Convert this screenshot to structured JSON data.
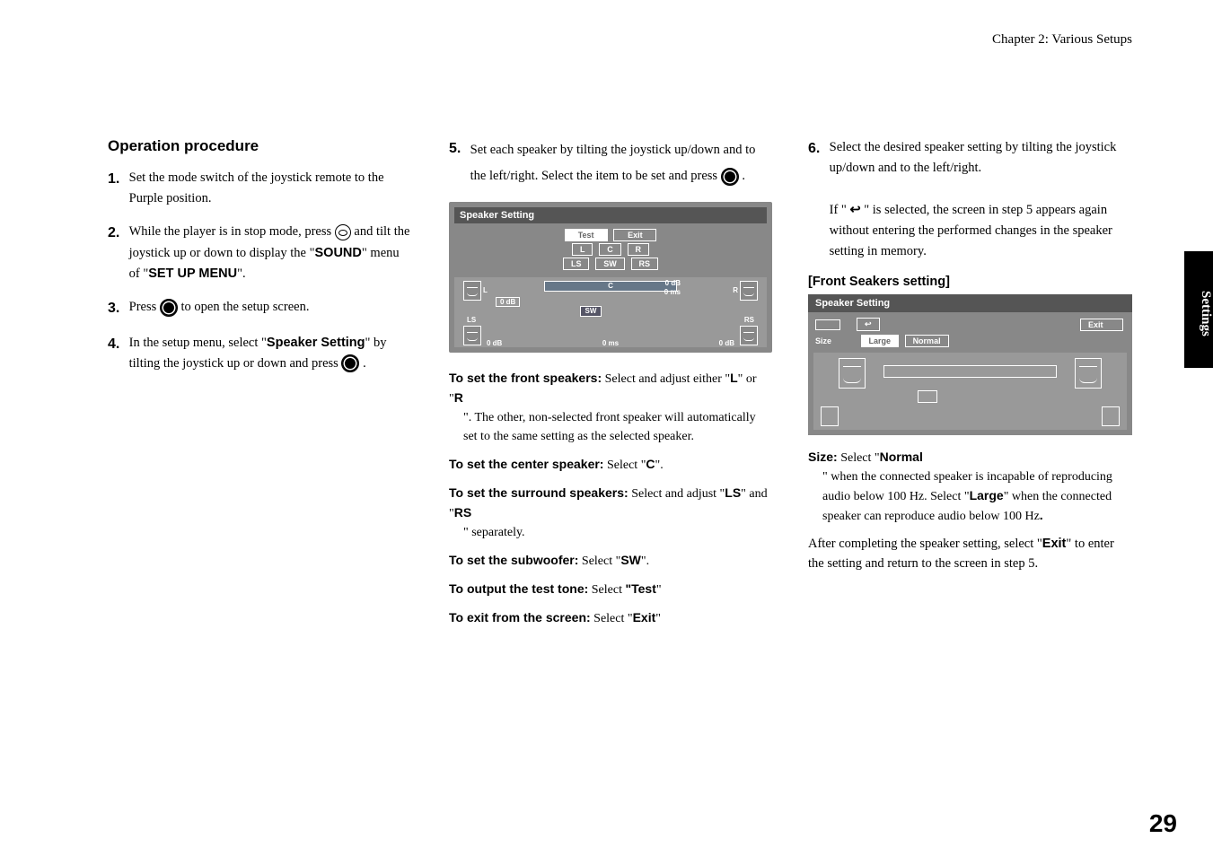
{
  "header": {
    "chapter": "Chapter 2: Various Setups"
  },
  "section": {
    "title": "Operation procedure"
  },
  "steps": {
    "s1": {
      "num": "1.",
      "text": "Set the mode switch of the joystick remote to the Purple position."
    },
    "s2": {
      "num": "2.",
      "a": "While the player is in stop mode, press ",
      "b": " and tilt the joystick up or down to display the \"",
      "sound": "SOUND",
      "c": "\" menu of \"",
      "menu": "SET UP MENU",
      "d": "\"."
    },
    "s3": {
      "num": "3.",
      "a": "Press ",
      "b": " to open the setup screen."
    },
    "s4": {
      "num": "4.",
      "a": "In the setup menu, select \"",
      "ss": "Speaker Setting",
      "b": "\" by tilting the joystick up or down and press ",
      "c": " ."
    },
    "s5": {
      "num": "5.",
      "a": "Set each speaker by tilting the joystick up/down and to the left/right. Select the item to be set and press ",
      "b": " ."
    },
    "s6": {
      "num": "6.",
      "a": "Select the desired speaker setting by tilting the joystick up/down and to the left/right.",
      "b1": "If \" ",
      "b2": " \" is selected, the screen in step 5 appears again without entering the performed changes in the speaker setting in memory."
    }
  },
  "osd1": {
    "title": "Speaker Setting",
    "test": "Test",
    "exit": "Exit",
    "L": "L",
    "C": "C",
    "R": "R",
    "LS": "LS",
    "SW": "SW",
    "RS": "RS",
    "v0db": "0  dB",
    "v0ms": "0 ms",
    "cval1": "0  dB",
    "cval2": "0 ms",
    "b1": "0  dB",
    "b2": "0  ms",
    "b3": "0  dB",
    "zero": "0 dB"
  },
  "sub": {
    "front_t": "To set the front speakers:",
    "front_b": "  Select and adjust either \"",
    "L": "L",
    "or": "\" or \"",
    "R": "R",
    "front_c": "\". The other, non-selected front speaker will automatically set to the same setting as the selected speaker.",
    "center_t": "To set the center speaker:",
    "center_b": " Select \"",
    "C": "C",
    "q": "\".",
    "surr_t": "To set the surround speakers:",
    "surr_b": " Select and adjust \"",
    "LS": "LS",
    "and": "\" and \"",
    "RS": "RS",
    "sep": "\" separately.",
    "sw_t": "To set the subwoofer:",
    "sw_b": " Select \"",
    "SW": "SW",
    "test_t": "To output the test tone:",
    "test_b": " Select ",
    "Test": "\"Test",
    "tq": "\"",
    "exit_t": "To exit from the screen:",
    "exit_b": " Select \"",
    "Exit": "Exit"
  },
  "frontset": {
    "heading": "[Front Seakers setting]",
    "osd_title": "Speaker Setting",
    "exit": "Exit",
    "size": "Size",
    "large": "Large",
    "normal": "Normal",
    "sizet": "Size:",
    "sizeb": " Select \"",
    "Normal": "Normal",
    "sizec": "\" when the connected speaker is incapable of reproducing audio below 100 Hz. Select \"",
    "Large": "Large",
    "sized": "\" when the connected speaker can reproduce audio below 100 Hz",
    "dot": ".",
    "after": "After completing the speaker setting, select \"",
    "Exit": "Exit",
    "afterb": "\" to enter the setting and return to the screen in step 5."
  },
  "sidetab": "Settings",
  "pagenum": "29",
  "return": "↩"
}
